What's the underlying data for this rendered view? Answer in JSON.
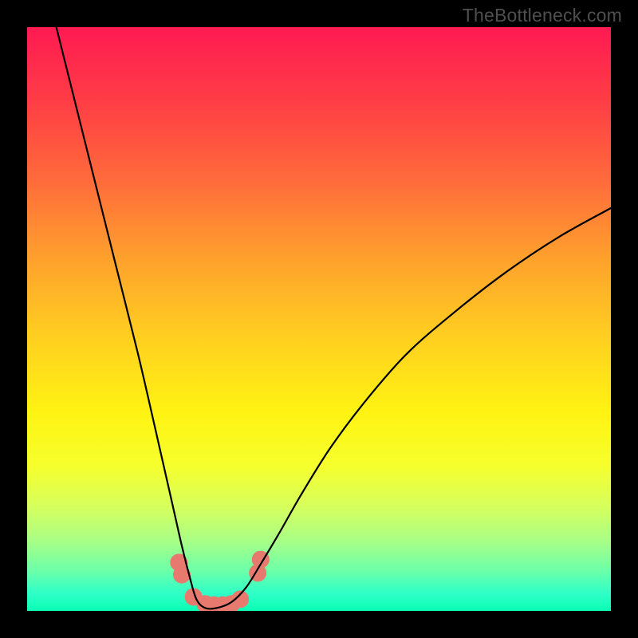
{
  "watermark": "TheBottleneck.com",
  "chart_data": {
    "type": "line",
    "title": "",
    "xlabel": "",
    "ylabel": "",
    "xlim": [
      0,
      1
    ],
    "ylim": [
      0,
      1
    ],
    "series": [
      {
        "name": "curve",
        "color": "#000000",
        "x": [
          0.05,
          0.085,
          0.12,
          0.155,
          0.19,
          0.22,
          0.245,
          0.263,
          0.278,
          0.29,
          0.305,
          0.325,
          0.35,
          0.375,
          0.4,
          0.43,
          0.47,
          0.52,
          0.58,
          0.65,
          0.73,
          0.82,
          0.91,
          1.0
        ],
        "y": [
          1.0,
          0.86,
          0.72,
          0.58,
          0.44,
          0.31,
          0.2,
          0.12,
          0.06,
          0.02,
          0.005,
          0.005,
          0.015,
          0.04,
          0.08,
          0.13,
          0.2,
          0.28,
          0.36,
          0.44,
          0.51,
          0.58,
          0.64,
          0.69
        ]
      }
    ],
    "markers": [
      {
        "x": 0.26,
        "y": 0.083,
        "r": 11,
        "color": "#e8796f"
      },
      {
        "x": 0.265,
        "y": 0.062,
        "r": 11,
        "color": "#e8796f"
      },
      {
        "x": 0.285,
        "y": 0.024,
        "r": 11,
        "color": "#e8796f"
      },
      {
        "x": 0.305,
        "y": 0.012,
        "r": 11,
        "color": "#e8796f"
      },
      {
        "x": 0.32,
        "y": 0.01,
        "r": 11,
        "color": "#e8796f"
      },
      {
        "x": 0.335,
        "y": 0.01,
        "r": 11,
        "color": "#e8796f"
      },
      {
        "x": 0.35,
        "y": 0.012,
        "r": 11,
        "color": "#e8796f"
      },
      {
        "x": 0.365,
        "y": 0.02,
        "r": 11,
        "color": "#e8796f"
      },
      {
        "x": 0.395,
        "y": 0.065,
        "r": 11,
        "color": "#e8796f"
      },
      {
        "x": 0.4,
        "y": 0.088,
        "r": 11,
        "color": "#e8796f"
      }
    ]
  }
}
